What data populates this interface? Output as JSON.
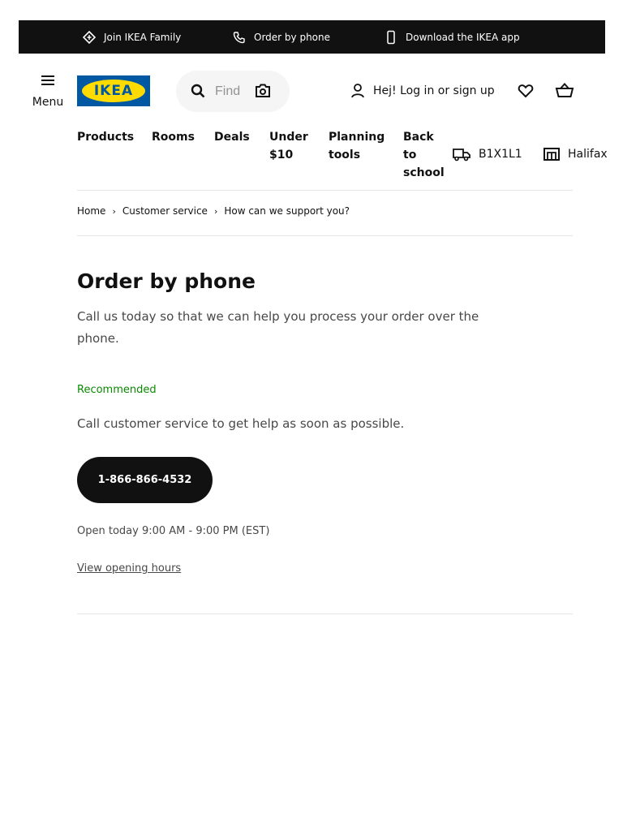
{
  "topbar": {
    "items": [
      {
        "label": "Join IKEA Family",
        "icon": "ikea-family-icon"
      },
      {
        "label": "Order by phone",
        "icon": "phone-icon"
      },
      {
        "label": "Download the IKEA app",
        "icon": "mobile-icon"
      }
    ]
  },
  "header": {
    "menu_label": "Menu",
    "logo_text": "IKEA",
    "search_placeholder": "Find",
    "login_label": "Hej! Log in or sign up",
    "icons": [
      "menu-icon",
      "search-icon",
      "camera-icon",
      "user-icon",
      "heart-icon",
      "cart-icon"
    ]
  },
  "nav": {
    "links": [
      {
        "label_lines": [
          "Products"
        ]
      },
      {
        "label_lines": [
          "Rooms"
        ]
      },
      {
        "label_lines": [
          "Deals"
        ]
      },
      {
        "label_lines": [
          "Under",
          "$10"
        ]
      },
      {
        "label_lines": [
          "Planning",
          "tools"
        ]
      },
      {
        "label_lines": [
          "Back",
          "to",
          "school"
        ]
      }
    ],
    "postal_code": "B1X1L1",
    "store": "Halifax"
  },
  "breadcrumb": [
    "Home",
    "Customer service",
    "How can we support you?"
  ],
  "main": {
    "title": "Order by phone",
    "intro": "Call us today so that we can help you process your order over the phone.",
    "recommended": "Recommended",
    "call_text": "Call customer service to get help as soon as possible.",
    "phone_number": "1-866-866-4532",
    "open_today": "Open today 9:00 AM - 9:00 PM (EST)",
    "hours_link": "View opening hours"
  },
  "colors": {
    "ikea_blue": "#0058a3",
    "ikea_yellow": "#ffdb00",
    "recommended_green": "#0a8a00",
    "dark": "#111111"
  }
}
